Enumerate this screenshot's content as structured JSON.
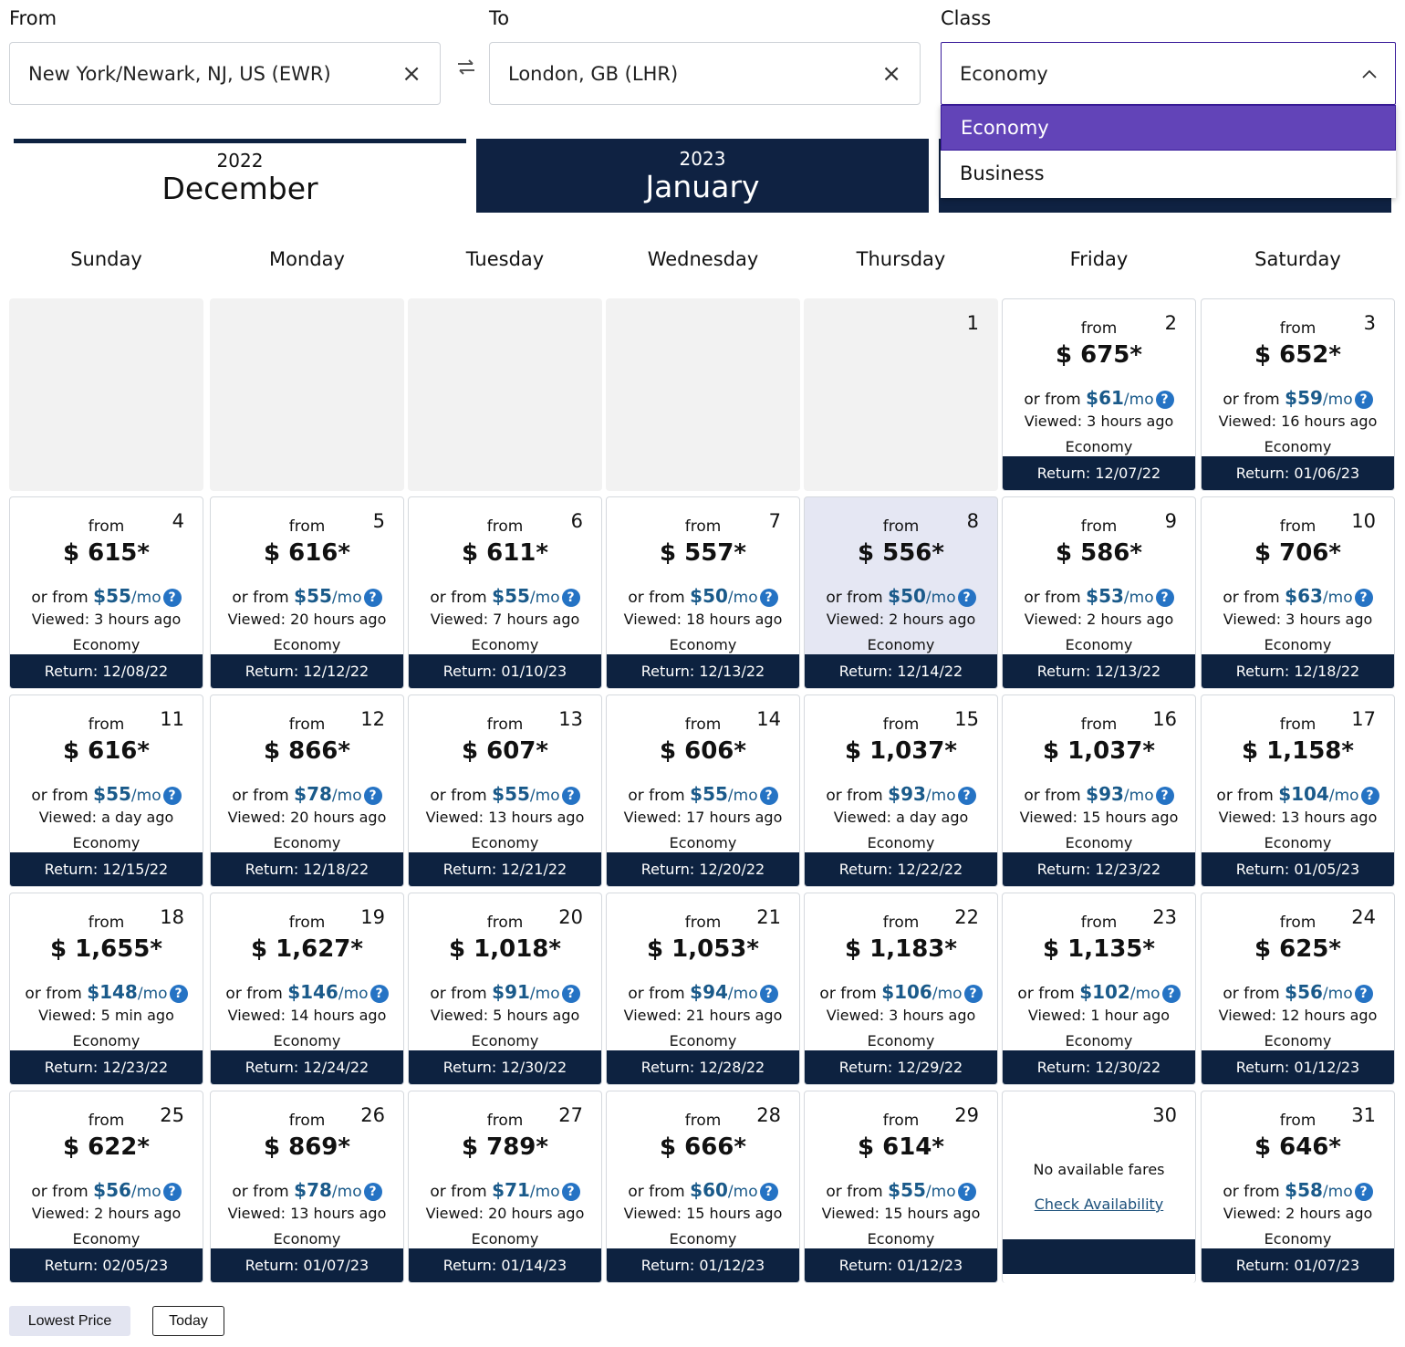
{
  "search": {
    "from_label": "From",
    "from_value": "New York/Newark, NJ, US (EWR)",
    "to_label": "To",
    "to_value": "London, GB (LHR)",
    "class_label": "Class",
    "class_value": "Economy",
    "class_options": [
      {
        "label": "Economy",
        "selected": true
      },
      {
        "label": "Business",
        "selected": false
      }
    ],
    "clear_icon": "×",
    "swap_icon": "swap-arrows-icon"
  },
  "month_tabs": [
    {
      "year": "2022",
      "month": "December",
      "active": true
    },
    {
      "year": "2023",
      "month": "January",
      "active": false
    },
    {
      "year": "",
      "month": "",
      "active": false
    }
  ],
  "weekdays": [
    "Sunday",
    "Monday",
    "Tuesday",
    "Wednesday",
    "Thursday",
    "Friday",
    "Saturday"
  ],
  "labels": {
    "from": "from",
    "or_from": "or from ",
    "per_month": "/mo",
    "help": "?",
    "return_prefix": "Return: ",
    "viewed_prefix": "Viewed: "
  },
  "days": [
    {
      "day": "1",
      "empty": true
    },
    {
      "day": "2",
      "price": "$ 675*",
      "monthly": "$61",
      "viewed": "3 hours ago",
      "cabin": "Economy",
      "return": "12/07/22"
    },
    {
      "day": "3",
      "price": "$ 652*",
      "monthly": "$59",
      "viewed": "16 hours ago",
      "cabin": "Economy",
      "return": "01/06/23"
    },
    {
      "day": "4",
      "price": "$ 615*",
      "monthly": "$55",
      "viewed": "3 hours ago",
      "cabin": "Economy",
      "return": "12/08/22"
    },
    {
      "day": "5",
      "price": "$ 616*",
      "monthly": "$55",
      "viewed": "20 hours ago",
      "cabin": "Economy",
      "return": "12/12/22"
    },
    {
      "day": "6",
      "price": "$ 611*",
      "monthly": "$55",
      "viewed": "7 hours ago",
      "cabin": "Economy",
      "return": "01/10/23"
    },
    {
      "day": "7",
      "price": "$ 557*",
      "monthly": "$50",
      "viewed": "18 hours ago",
      "cabin": "Economy",
      "return": "12/13/22"
    },
    {
      "day": "8",
      "price": "$ 556*",
      "monthly": "$50",
      "viewed": "2 hours ago",
      "cabin": "Economy",
      "return": "12/14/22",
      "highlight": true
    },
    {
      "day": "9",
      "price": "$ 586*",
      "monthly": "$53",
      "viewed": "2 hours ago",
      "cabin": "Economy",
      "return": "12/13/22"
    },
    {
      "day": "10",
      "price": "$ 706*",
      "monthly": "$63",
      "viewed": "3 hours ago",
      "cabin": "Economy",
      "return": "12/18/22"
    },
    {
      "day": "11",
      "price": "$ 616*",
      "monthly": "$55",
      "viewed": "a day ago",
      "cabin": "Economy",
      "return": "12/15/22"
    },
    {
      "day": "12",
      "price": "$ 866*",
      "monthly": "$78",
      "viewed": "20 hours ago",
      "cabin": "Economy",
      "return": "12/18/22"
    },
    {
      "day": "13",
      "price": "$ 607*",
      "monthly": "$55",
      "viewed": "13 hours ago",
      "cabin": "Economy",
      "return": "12/21/22"
    },
    {
      "day": "14",
      "price": "$ 606*",
      "monthly": "$55",
      "viewed": "17 hours ago",
      "cabin": "Economy",
      "return": "12/20/22"
    },
    {
      "day": "15",
      "price": "$ 1,037*",
      "monthly": "$93",
      "viewed": "a day ago",
      "cabin": "Economy",
      "return": "12/22/22"
    },
    {
      "day": "16",
      "price": "$ 1,037*",
      "monthly": "$93",
      "viewed": "15 hours ago",
      "cabin": "Economy",
      "return": "12/23/22"
    },
    {
      "day": "17",
      "price": "$ 1,158*",
      "monthly": "$104",
      "viewed": "13 hours ago",
      "cabin": "Economy",
      "return": "01/05/23"
    },
    {
      "day": "18",
      "price": "$ 1,655*",
      "monthly": "$148",
      "viewed": "5 min ago",
      "cabin": "Economy",
      "return": "12/23/22"
    },
    {
      "day": "19",
      "price": "$ 1,627*",
      "monthly": "$146",
      "viewed": "14 hours ago",
      "cabin": "Economy",
      "return": "12/24/22"
    },
    {
      "day": "20",
      "price": "$ 1,018*",
      "monthly": "$91",
      "viewed": "5 hours ago",
      "cabin": "Economy",
      "return": "12/30/22"
    },
    {
      "day": "21",
      "price": "$ 1,053*",
      "monthly": "$94",
      "viewed": "21 hours ago",
      "cabin": "Economy",
      "return": "12/28/22"
    },
    {
      "day": "22",
      "price": "$ 1,183*",
      "monthly": "$106",
      "viewed": "3 hours ago",
      "cabin": "Economy",
      "return": "12/29/22"
    },
    {
      "day": "23",
      "price": "$ 1,135*",
      "monthly": "$102",
      "viewed": "1 hour ago",
      "cabin": "Economy",
      "return": "12/30/22"
    },
    {
      "day": "24",
      "price": "$ 625*",
      "monthly": "$56",
      "viewed": "12 hours ago",
      "cabin": "Economy",
      "return": "01/12/23"
    },
    {
      "day": "25",
      "price": "$ 622*",
      "monthly": "$56",
      "viewed": "2 hours ago",
      "cabin": "Economy",
      "return": "02/05/23"
    },
    {
      "day": "26",
      "price": "$ 869*",
      "monthly": "$78",
      "viewed": "13 hours ago",
      "cabin": "Economy",
      "return": "01/07/23"
    },
    {
      "day": "27",
      "price": "$ 789*",
      "monthly": "$71",
      "viewed": "20 hours ago",
      "cabin": "Economy",
      "return": "01/14/23"
    },
    {
      "day": "28",
      "price": "$ 666*",
      "monthly": "$60",
      "viewed": "15 hours ago",
      "cabin": "Economy",
      "return": "01/12/23"
    },
    {
      "day": "29",
      "price": "$ 614*",
      "monthly": "$55",
      "viewed": "15 hours ago",
      "cabin": "Economy",
      "return": "01/12/23"
    },
    {
      "day": "30",
      "no_fare": true,
      "no_fare_text": "No available fares",
      "check_text": "Check Availability"
    },
    {
      "day": "31",
      "price": "$ 646*",
      "monthly": "$58",
      "viewed": "2 hours ago",
      "cabin": "Economy",
      "return": "01/07/23"
    }
  ],
  "footer": {
    "lowest_price": "Lowest Price",
    "today": "Today"
  }
}
